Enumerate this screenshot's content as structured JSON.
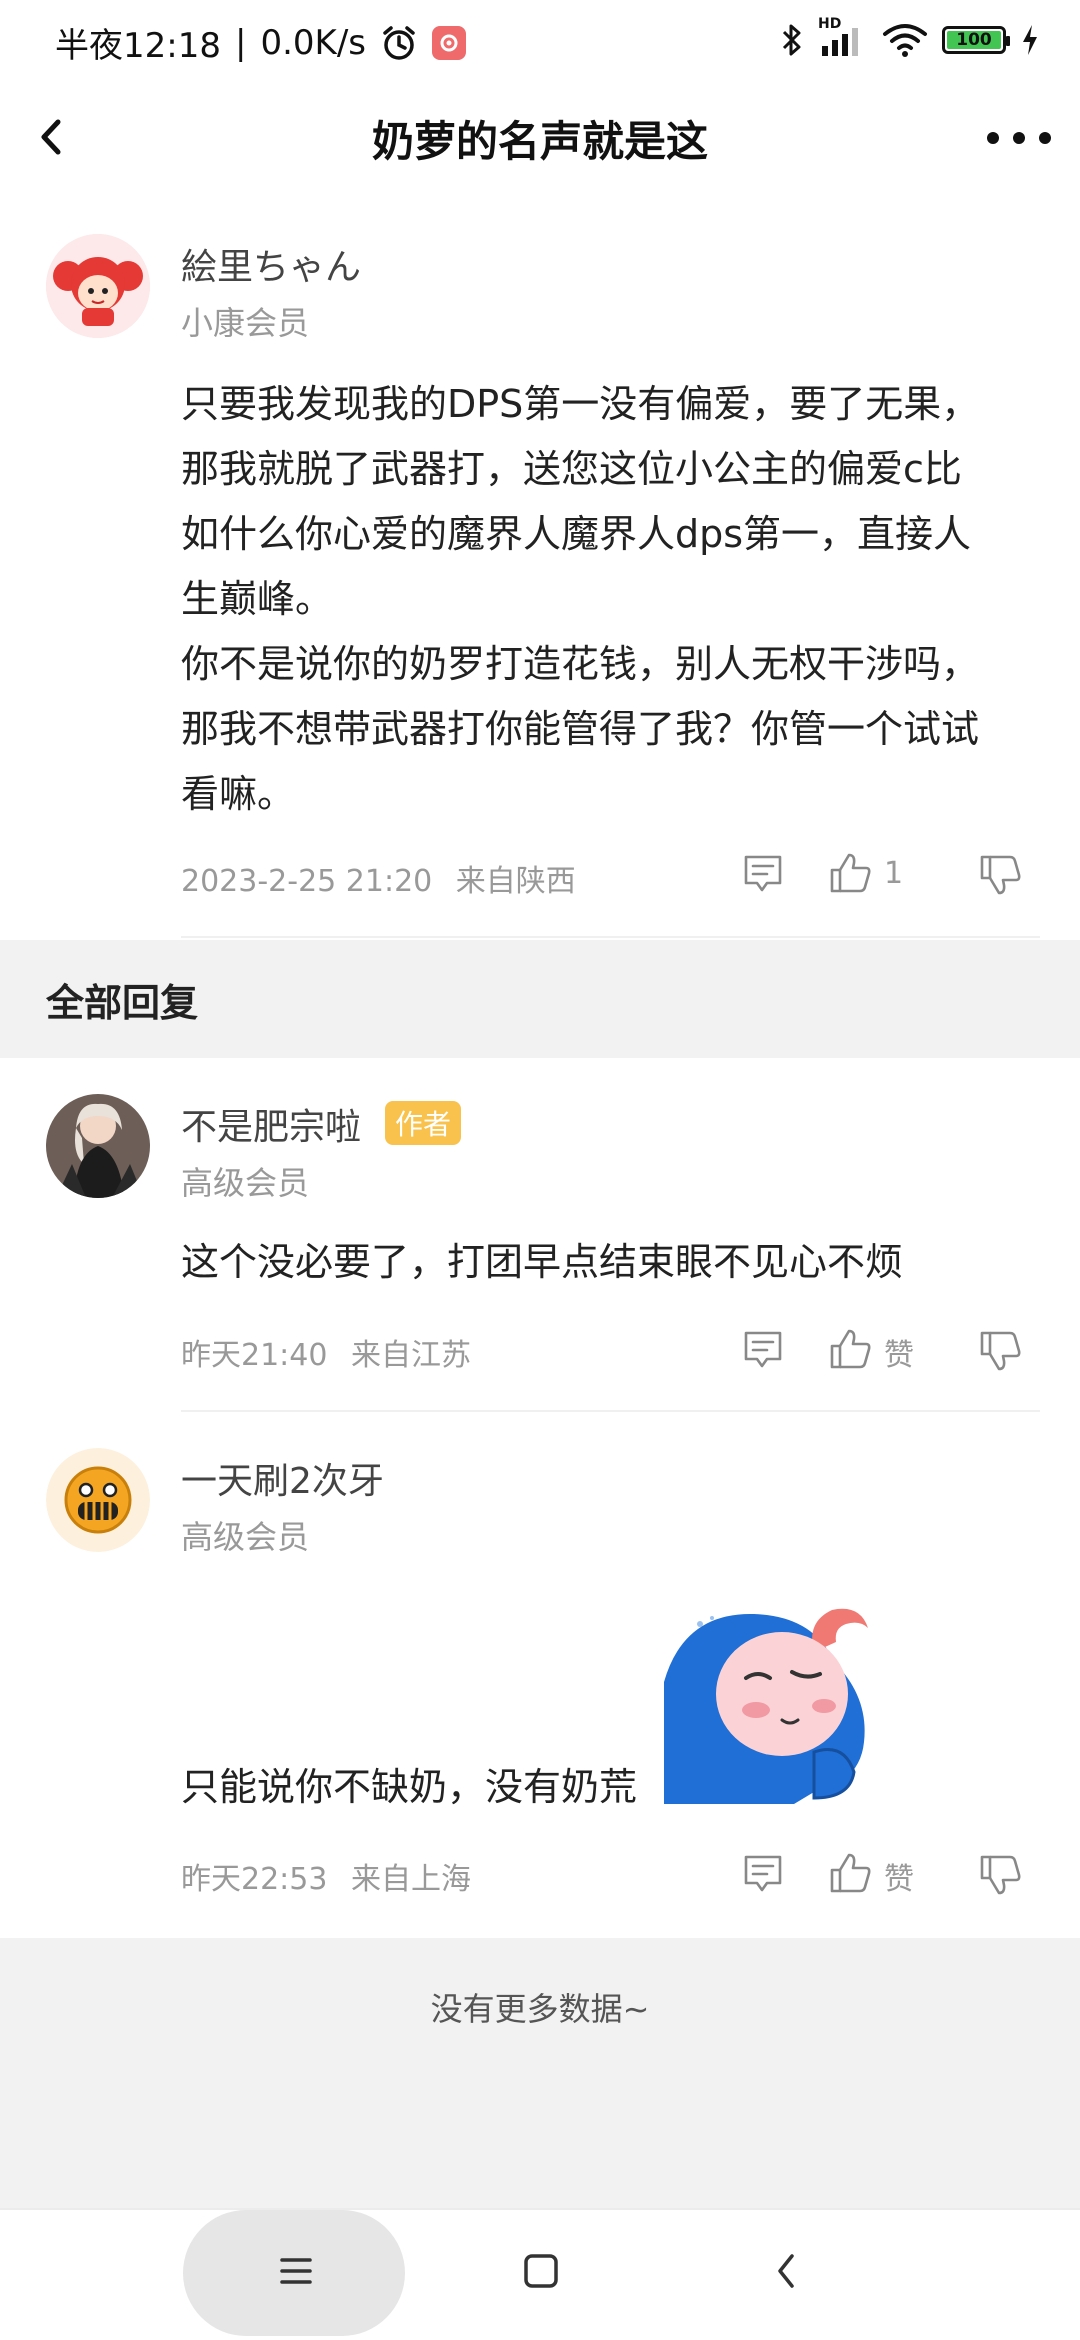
{
  "status_bar": {
    "time": "半夜12:18",
    "network_speed": "0.0K/s",
    "network_type": "HD",
    "battery": "100",
    "battery_level": 100,
    "icons": [
      "alarm-clock-icon",
      "app-notification-icon",
      "bluetooth-icon",
      "signal-icon",
      "wifi-icon",
      "battery-icon",
      "charging-icon"
    ]
  },
  "nav": {
    "title": "奶萝的名声就是这",
    "back_icon": "back-chevron-icon",
    "more_icon": "more-dots-icon"
  },
  "main_post": {
    "username": "絵里ちゃん",
    "level": "小康会员",
    "content_lines": [
      "只要我发现我的DPS第一没有偏爱，要了无果，",
      "那我就脱了武器打，送您这位小公主的偏爱c比",
      "如什么你心爱的魔界人魔界人dps第一，直接人",
      "生巅峰。",
      "你不是说你的奶罗打造花钱，别人无权干涉吗，",
      "那我不想带武器打你能管得了我？你管一个试试",
      "看嘛。"
    ],
    "time": "2023-2-25 21:20",
    "location": "来自陕西",
    "like_count": "1"
  },
  "section": {
    "title": "全部回复"
  },
  "replies": [
    {
      "username": "不是肥宗啦",
      "tag": "作者",
      "level": "高级会员",
      "content": "这个没必要了，打团早点结束眼不见心不烦",
      "time": "昨天21:40",
      "location": "来自江苏",
      "like_label": "赞"
    },
    {
      "username": "一天刷2次牙",
      "level": "高级会员",
      "content": "只能说你不缺奶，没有奶荒",
      "time": "昨天22:53",
      "location": "来自上海",
      "like_label": "赞"
    }
  ],
  "footer": {
    "no_more": "没有更多数据~"
  },
  "colors": {
    "accent_author_tag": "#f8c24d",
    "background_band": "#f2f2f2",
    "meta_text": "#999999"
  }
}
